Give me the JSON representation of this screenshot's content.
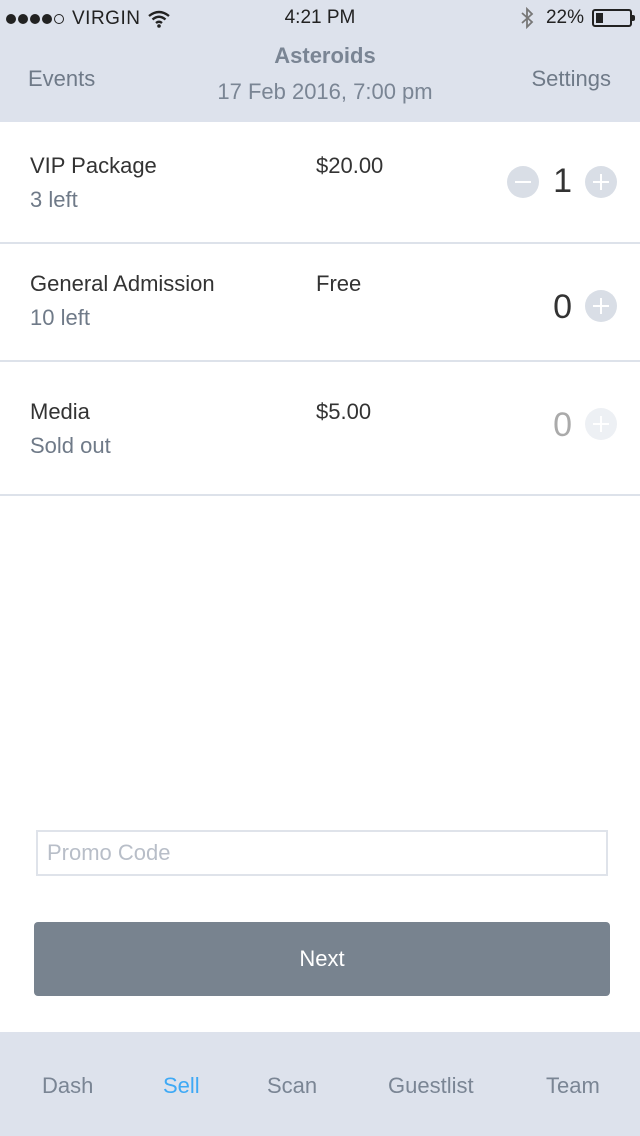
{
  "status_bar": {
    "carrier": "VIRGIN",
    "time": "4:21 PM",
    "battery_percent": "22%",
    "battery_level": 0.22,
    "signal_bars_filled": 4,
    "signal_bars_total": 5
  },
  "nav": {
    "back_label": "Events",
    "title": "Asteroids",
    "subtitle": "17 Feb 2016, 7:00 pm",
    "settings_label": "Settings"
  },
  "tickets": [
    {
      "name": "VIP Package",
      "availability": "3 left",
      "price": "$20.00",
      "quantity": "1",
      "can_decrease": true,
      "can_increase": true
    },
    {
      "name": "General Admission",
      "availability": "10 left",
      "price": "Free",
      "quantity": "0",
      "can_decrease": false,
      "can_increase": true
    },
    {
      "name": "Media",
      "availability": "Sold out",
      "price": "$5.00",
      "quantity": "0",
      "can_decrease": false,
      "can_increase": false
    }
  ],
  "promo": {
    "placeholder": "Promo Code",
    "value": ""
  },
  "next_label": "Next",
  "tabs": [
    {
      "label": "Dash",
      "active": false
    },
    {
      "label": "Sell",
      "active": true
    },
    {
      "label": "Scan",
      "active": false
    },
    {
      "label": "Guestlist",
      "active": false
    },
    {
      "label": "Team",
      "active": false
    }
  ],
  "colors": {
    "header_bg": "#dde2ec",
    "accent": "#3ea9f5",
    "button_bg": "#78838f",
    "muted_text": "#6f7a88"
  }
}
